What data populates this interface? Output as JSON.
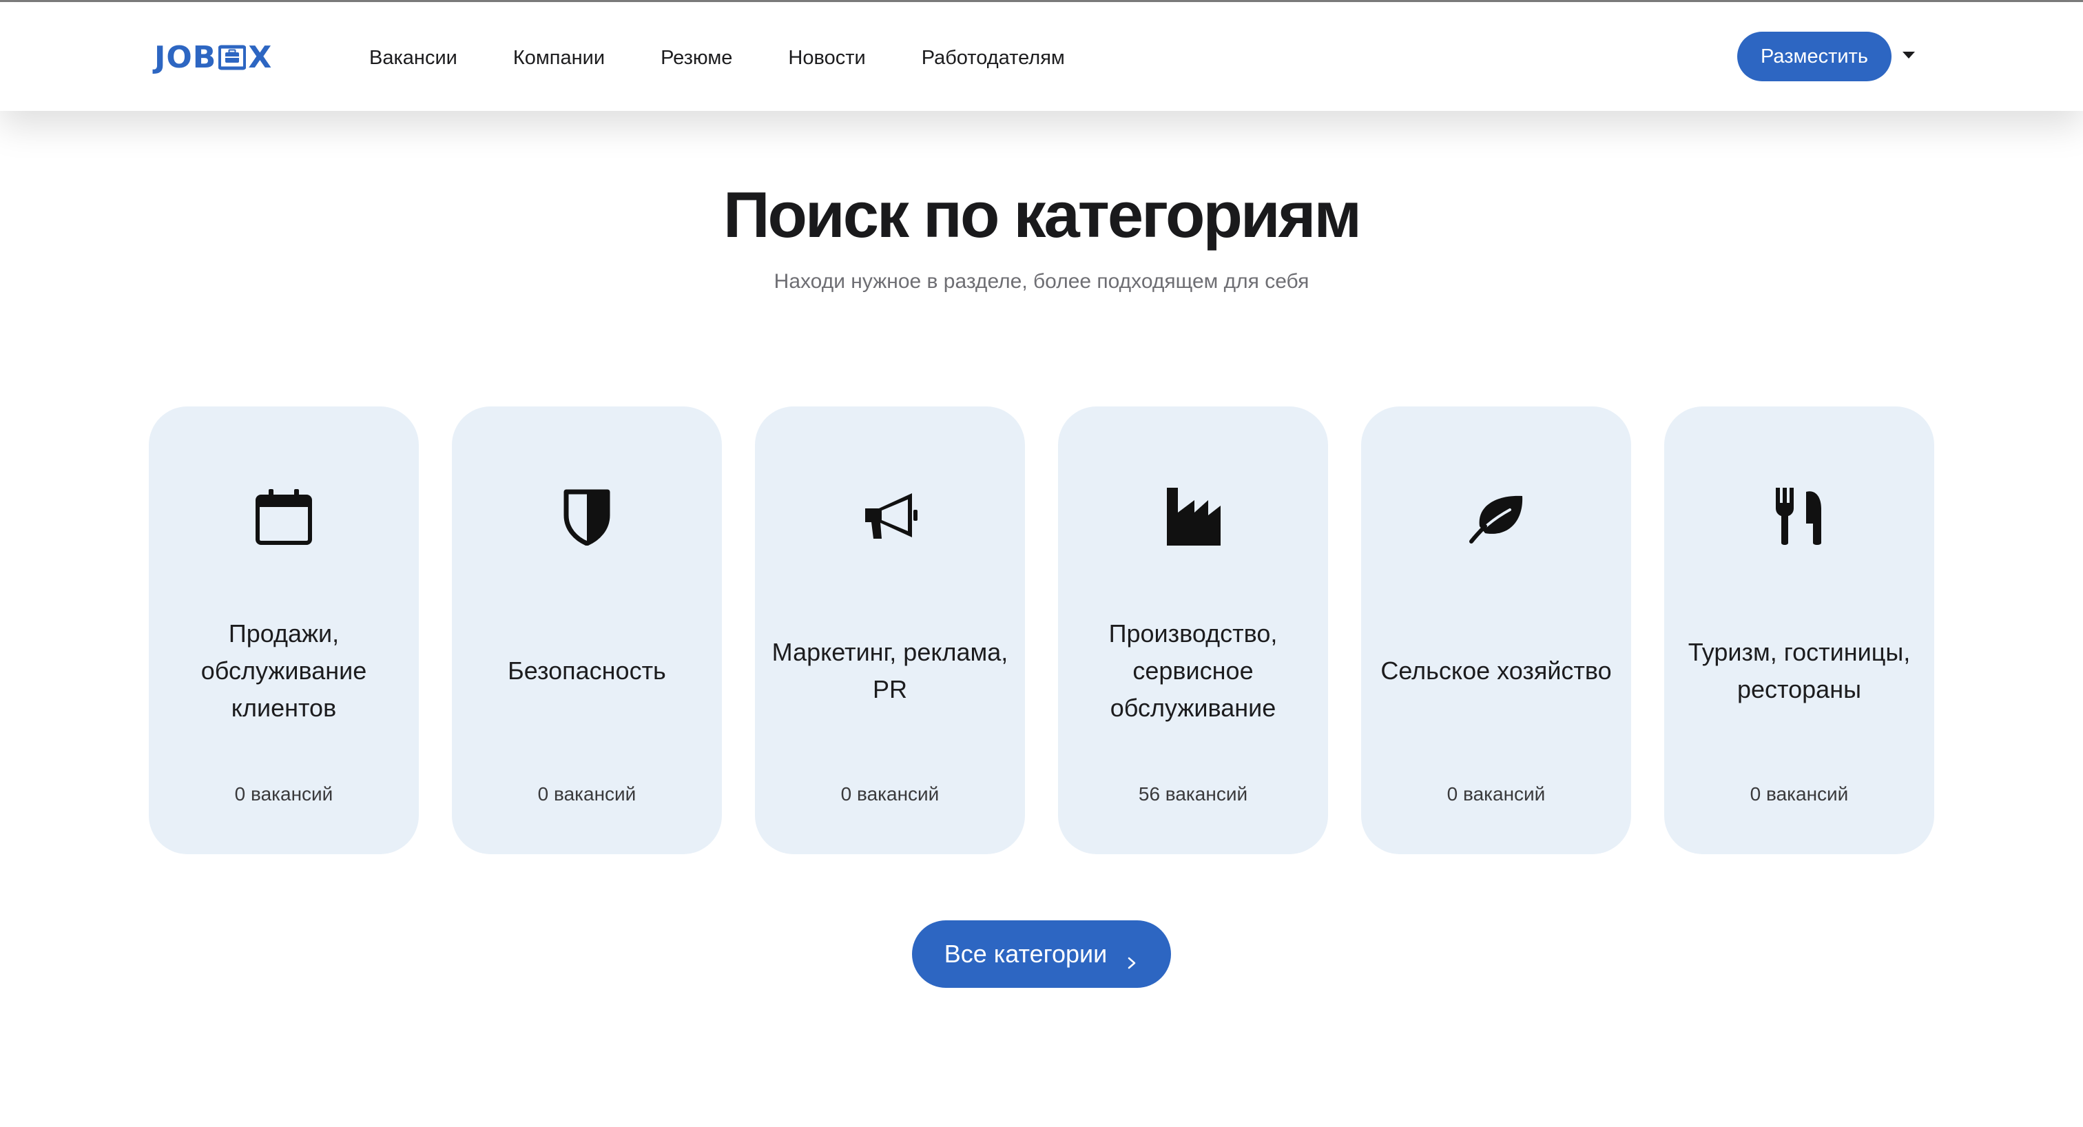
{
  "header": {
    "logo_text_left": "JOB",
    "logo_text_right": "X",
    "nav": [
      {
        "label": "Вакансии"
      },
      {
        "label": "Компании"
      },
      {
        "label": "Резюме"
      },
      {
        "label": "Новости"
      },
      {
        "label": "Работодателям"
      }
    ],
    "post_button_label": "Разместить",
    "dropdown_icon": "caret-down-icon"
  },
  "main": {
    "title": "Поиск по категориям",
    "subtitle": "Находи нужное в разделе, более подходящем для себя",
    "categories": [
      {
        "icon": "calendar-icon",
        "title": "Продажи, обслуживание клиентов",
        "count": "0 вакансий"
      },
      {
        "icon": "shield-icon",
        "title": "Безопасность",
        "count": "0 вакансий"
      },
      {
        "icon": "megaphone-icon",
        "title": "Маркетинг, реклама, PR",
        "count": "0 вакансий"
      },
      {
        "icon": "factory-icon",
        "title": "Производство, сервисное обслуживание",
        "count": "56 вакансий"
      },
      {
        "icon": "leaf-icon",
        "title": "Сельское хозяйство",
        "count": "0 вакансий"
      },
      {
        "icon": "utensils-icon",
        "title": "Туризм, гостиницы, рестораны",
        "count": "0 вакансий"
      }
    ],
    "all_categories_label": "Все категории",
    "all_categories_icon": "chevron-right-icon"
  },
  "colors": {
    "accent": "#2d66c2",
    "card_background": "#e8f0f8",
    "text": "#1c1c1e",
    "muted_text": "#6e6e73"
  }
}
